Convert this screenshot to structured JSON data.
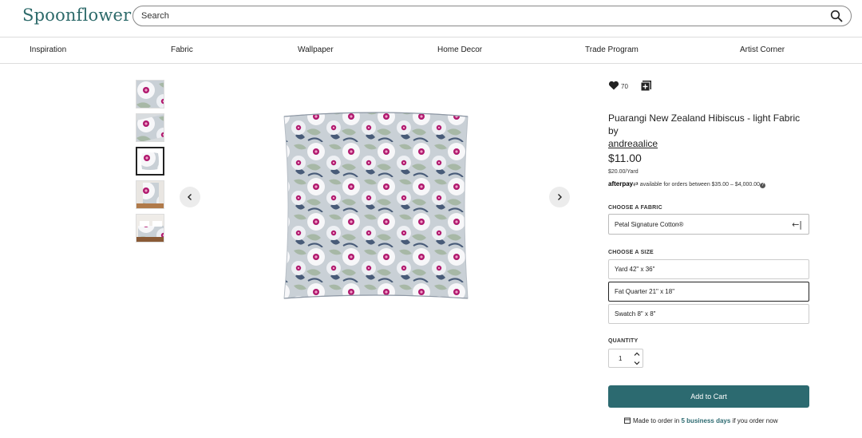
{
  "header": {
    "logo": "Spoonflower",
    "search_placeholder": "Search",
    "search_icon": "search-icon"
  },
  "nav": {
    "items": [
      {
        "label": "Inspiration"
      },
      {
        "label": "Fabric"
      },
      {
        "label": "Wallpaper"
      },
      {
        "label": "Home Decor"
      },
      {
        "label": "Trade Program"
      },
      {
        "label": "Artist Corner"
      }
    ]
  },
  "gallery": {
    "thumbnails": [
      "fabric-swatch",
      "fabric-fold",
      "pillow",
      "curtain",
      "bedding"
    ],
    "selected_index": 2,
    "prev_icon": "chevron-left-icon",
    "next_icon": "chevron-right-icon"
  },
  "product": {
    "favorite_count": "70",
    "title_text": "Puarangi New Zealand Hibiscus - light Fabric by",
    "author": "andreaalice",
    "price": "$11.00",
    "unit_price": "$20.00/Yard",
    "afterpay_logo": "afterpay",
    "afterpay_text": "available for orders between $35.00 – $4,000.00",
    "fabric_label": "CHOOSE A FABRIC",
    "fabric_value": "Petal Signature Cotton®",
    "size_label": "CHOOSE A SIZE",
    "sizes": [
      {
        "label": "Yard 42\" x 36\""
      },
      {
        "label": "Fat Quarter 21\" x 18\""
      },
      {
        "label": "Swatch 8\" x 8\""
      }
    ],
    "selected_size_index": 1,
    "quantity_label": "QUANTITY",
    "quantity": "1",
    "add_to_cart": "Add to Cart",
    "made_prefix": "Made to order in",
    "made_days": "5 business days",
    "made_suffix": "if you order now"
  },
  "colors": {
    "brand": "#2d6a6a",
    "cart_button": "#2c6a70",
    "hibiscus_magenta": "#b0186e"
  }
}
